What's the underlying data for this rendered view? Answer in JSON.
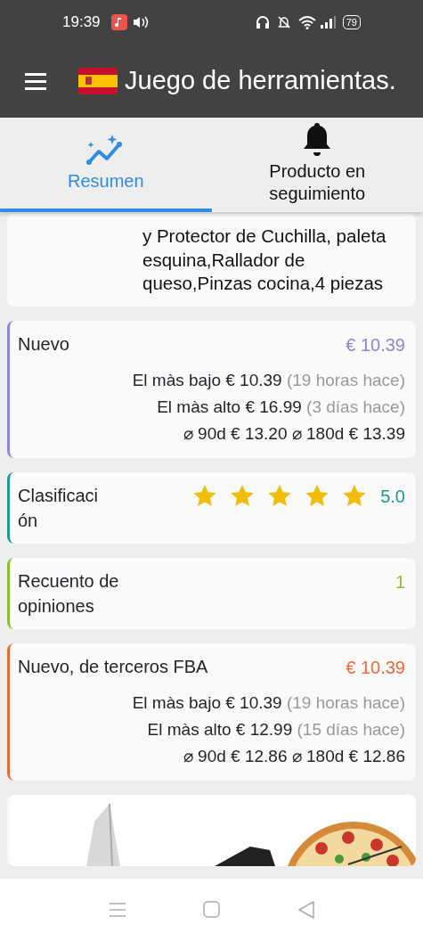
{
  "status_bar": {
    "time": "19:39",
    "battery": "79"
  },
  "app_bar": {
    "title": "Juego de herramientas."
  },
  "tabs": [
    {
      "label": "Resumen",
      "selected": true,
      "kind": "chart"
    },
    {
      "label": "Producto en seguimiento",
      "selected": false,
      "kind": "bell"
    }
  ],
  "description": {
    "text": "y Protector de Cuchilla, paleta esquina,Rallador de queso,Pinzas cocina,4 piezas"
  },
  "cards": [
    {
      "kind": "price",
      "label": "Nuevo",
      "value": "€ 10.39",
      "color": "#8a86d6",
      "stats": [
        {
          "label": "El màs bajo € 10.39",
          "ago": "(19 horas hace)"
        },
        {
          "label": "El màs alto € 16.99",
          "ago": "(3 días hace)"
        }
      ],
      "averages": "⌀ 90d € 13.20 ⌀ 180d € 13.39"
    },
    {
      "kind": "rating",
      "label": "Clasificaci ón",
      "stars": 5,
      "value": "5.0",
      "color": "#1a9a8a"
    },
    {
      "kind": "count",
      "label": "Recuento de opiniones",
      "value": "1",
      "color": "#8cbf26"
    },
    {
      "kind": "price",
      "label": "Nuevo, de terceros FBA",
      "value": "€ 10.39",
      "color": "#f06a35",
      "stats": [
        {
          "label": "El màs bajo € 10.39",
          "ago": "(19 horas hace)"
        },
        {
          "label": "El màs alto € 12.99",
          "ago": "(15 días hace)"
        }
      ],
      "averages": "⌀ 90d € 12.86 ⌀ 180d € 12.86"
    },
    {
      "kind": "picture"
    }
  ]
}
